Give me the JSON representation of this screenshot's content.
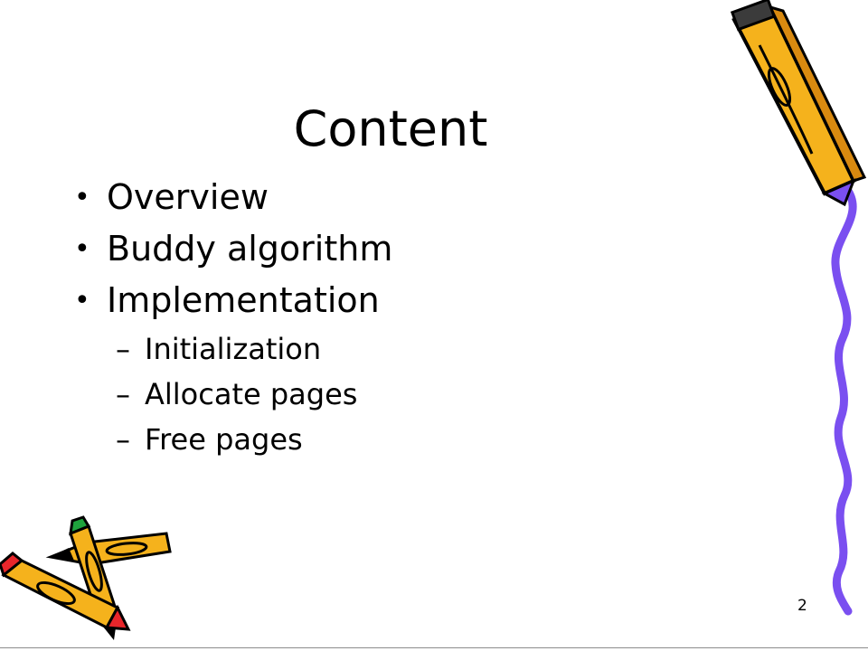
{
  "slide": {
    "title": "Content",
    "bullet_symbol": "•",
    "sub_symbol": "–",
    "items": [
      {
        "label": "Overview"
      },
      {
        "label": "Buddy algorithm"
      },
      {
        "label": "Implementation",
        "subitems": [
          "Initialization",
          "Allocate pages",
          "Free pages"
        ]
      }
    ],
    "page_number": "2"
  },
  "decorations": {
    "top_right": "pencil-icon",
    "bottom_left": "crossed-pencils-icon",
    "right_edge": "squiggle-line",
    "colors": {
      "pencil_body": "#f5b21c",
      "pencil_tip": "#7a4ff0",
      "squiggle": "#7a4ff0",
      "red_eraser": "#e8262b",
      "green_cap": "#1fa33d"
    }
  }
}
